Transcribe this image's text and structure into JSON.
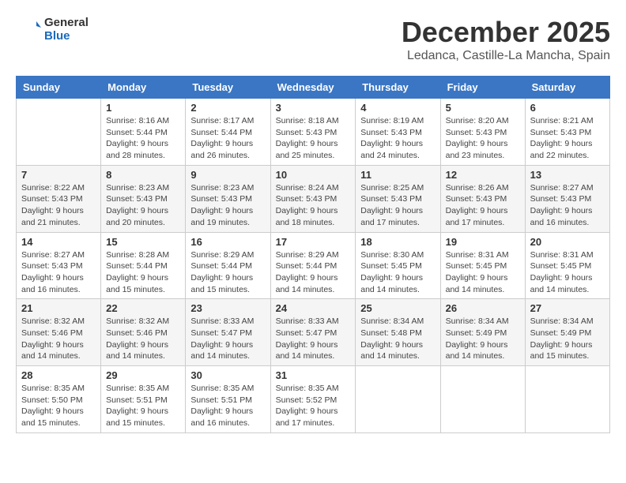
{
  "header": {
    "logo_line1": "General",
    "logo_line2": "Blue",
    "month_title": "December 2025",
    "location": "Ledanca, Castille-La Mancha, Spain"
  },
  "days_of_week": [
    "Sunday",
    "Monday",
    "Tuesday",
    "Wednesday",
    "Thursday",
    "Friday",
    "Saturday"
  ],
  "weeks": [
    [
      {
        "day": "",
        "sunrise": "",
        "sunset": "",
        "daylight": ""
      },
      {
        "day": "1",
        "sunrise": "Sunrise: 8:16 AM",
        "sunset": "Sunset: 5:44 PM",
        "daylight": "Daylight: 9 hours and 28 minutes."
      },
      {
        "day": "2",
        "sunrise": "Sunrise: 8:17 AM",
        "sunset": "Sunset: 5:44 PM",
        "daylight": "Daylight: 9 hours and 26 minutes."
      },
      {
        "day": "3",
        "sunrise": "Sunrise: 8:18 AM",
        "sunset": "Sunset: 5:43 PM",
        "daylight": "Daylight: 9 hours and 25 minutes."
      },
      {
        "day": "4",
        "sunrise": "Sunrise: 8:19 AM",
        "sunset": "Sunset: 5:43 PM",
        "daylight": "Daylight: 9 hours and 24 minutes."
      },
      {
        "day": "5",
        "sunrise": "Sunrise: 8:20 AM",
        "sunset": "Sunset: 5:43 PM",
        "daylight": "Daylight: 9 hours and 23 minutes."
      },
      {
        "day": "6",
        "sunrise": "Sunrise: 8:21 AM",
        "sunset": "Sunset: 5:43 PM",
        "daylight": "Daylight: 9 hours and 22 minutes."
      }
    ],
    [
      {
        "day": "7",
        "sunrise": "Sunrise: 8:22 AM",
        "sunset": "Sunset: 5:43 PM",
        "daylight": "Daylight: 9 hours and 21 minutes."
      },
      {
        "day": "8",
        "sunrise": "Sunrise: 8:23 AM",
        "sunset": "Sunset: 5:43 PM",
        "daylight": "Daylight: 9 hours and 20 minutes."
      },
      {
        "day": "9",
        "sunrise": "Sunrise: 8:23 AM",
        "sunset": "Sunset: 5:43 PM",
        "daylight": "Daylight: 9 hours and 19 minutes."
      },
      {
        "day": "10",
        "sunrise": "Sunrise: 8:24 AM",
        "sunset": "Sunset: 5:43 PM",
        "daylight": "Daylight: 9 hours and 18 minutes."
      },
      {
        "day": "11",
        "sunrise": "Sunrise: 8:25 AM",
        "sunset": "Sunset: 5:43 PM",
        "daylight": "Daylight: 9 hours and 17 minutes."
      },
      {
        "day": "12",
        "sunrise": "Sunrise: 8:26 AM",
        "sunset": "Sunset: 5:43 PM",
        "daylight": "Daylight: 9 hours and 17 minutes."
      },
      {
        "day": "13",
        "sunrise": "Sunrise: 8:27 AM",
        "sunset": "Sunset: 5:43 PM",
        "daylight": "Daylight: 9 hours and 16 minutes."
      }
    ],
    [
      {
        "day": "14",
        "sunrise": "Sunrise: 8:27 AM",
        "sunset": "Sunset: 5:43 PM",
        "daylight": "Daylight: 9 hours and 16 minutes."
      },
      {
        "day": "15",
        "sunrise": "Sunrise: 8:28 AM",
        "sunset": "Sunset: 5:44 PM",
        "daylight": "Daylight: 9 hours and 15 minutes."
      },
      {
        "day": "16",
        "sunrise": "Sunrise: 8:29 AM",
        "sunset": "Sunset: 5:44 PM",
        "daylight": "Daylight: 9 hours and 15 minutes."
      },
      {
        "day": "17",
        "sunrise": "Sunrise: 8:29 AM",
        "sunset": "Sunset: 5:44 PM",
        "daylight": "Daylight: 9 hours and 14 minutes."
      },
      {
        "day": "18",
        "sunrise": "Sunrise: 8:30 AM",
        "sunset": "Sunset: 5:45 PM",
        "daylight": "Daylight: 9 hours and 14 minutes."
      },
      {
        "day": "19",
        "sunrise": "Sunrise: 8:31 AM",
        "sunset": "Sunset: 5:45 PM",
        "daylight": "Daylight: 9 hours and 14 minutes."
      },
      {
        "day": "20",
        "sunrise": "Sunrise: 8:31 AM",
        "sunset": "Sunset: 5:45 PM",
        "daylight": "Daylight: 9 hours and 14 minutes."
      }
    ],
    [
      {
        "day": "21",
        "sunrise": "Sunrise: 8:32 AM",
        "sunset": "Sunset: 5:46 PM",
        "daylight": "Daylight: 9 hours and 14 minutes."
      },
      {
        "day": "22",
        "sunrise": "Sunrise: 8:32 AM",
        "sunset": "Sunset: 5:46 PM",
        "daylight": "Daylight: 9 hours and 14 minutes."
      },
      {
        "day": "23",
        "sunrise": "Sunrise: 8:33 AM",
        "sunset": "Sunset: 5:47 PM",
        "daylight": "Daylight: 9 hours and 14 minutes."
      },
      {
        "day": "24",
        "sunrise": "Sunrise: 8:33 AM",
        "sunset": "Sunset: 5:47 PM",
        "daylight": "Daylight: 9 hours and 14 minutes."
      },
      {
        "day": "25",
        "sunrise": "Sunrise: 8:34 AM",
        "sunset": "Sunset: 5:48 PM",
        "daylight": "Daylight: 9 hours and 14 minutes."
      },
      {
        "day": "26",
        "sunrise": "Sunrise: 8:34 AM",
        "sunset": "Sunset: 5:49 PM",
        "daylight": "Daylight: 9 hours and 14 minutes."
      },
      {
        "day": "27",
        "sunrise": "Sunrise: 8:34 AM",
        "sunset": "Sunset: 5:49 PM",
        "daylight": "Daylight: 9 hours and 15 minutes."
      }
    ],
    [
      {
        "day": "28",
        "sunrise": "Sunrise: 8:35 AM",
        "sunset": "Sunset: 5:50 PM",
        "daylight": "Daylight: 9 hours and 15 minutes."
      },
      {
        "day": "29",
        "sunrise": "Sunrise: 8:35 AM",
        "sunset": "Sunset: 5:51 PM",
        "daylight": "Daylight: 9 hours and 15 minutes."
      },
      {
        "day": "30",
        "sunrise": "Sunrise: 8:35 AM",
        "sunset": "Sunset: 5:51 PM",
        "daylight": "Daylight: 9 hours and 16 minutes."
      },
      {
        "day": "31",
        "sunrise": "Sunrise: 8:35 AM",
        "sunset": "Sunset: 5:52 PM",
        "daylight": "Daylight: 9 hours and 17 minutes."
      },
      {
        "day": "",
        "sunrise": "",
        "sunset": "",
        "daylight": ""
      },
      {
        "day": "",
        "sunrise": "",
        "sunset": "",
        "daylight": ""
      },
      {
        "day": "",
        "sunrise": "",
        "sunset": "",
        "daylight": ""
      }
    ]
  ]
}
